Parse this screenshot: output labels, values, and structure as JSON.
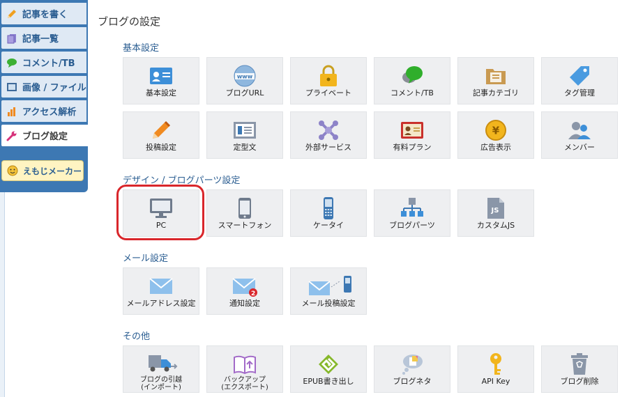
{
  "sidebar": {
    "items": [
      {
        "label": "記事を書く",
        "icon": "pencil-icon"
      },
      {
        "label": "記事一覧",
        "icon": "document-icon"
      },
      {
        "label": "コメント/TB",
        "icon": "comment-icon"
      },
      {
        "label": "画像 / ファイル",
        "icon": "image-icon"
      },
      {
        "label": "アクセス解析",
        "icon": "bar-chart-icon"
      },
      {
        "label": "ブログ設定",
        "icon": "wrench-icon"
      }
    ],
    "emoji_button": "えもじメーカー"
  },
  "page": {
    "title": "ブログの設定"
  },
  "sections": {
    "basic": {
      "title": "基本設定",
      "tiles": [
        {
          "label": "基本設定"
        },
        {
          "label": "ブログURL"
        },
        {
          "label": "プライベート"
        },
        {
          "label": "コメント/TB"
        },
        {
          "label": "記事カテゴリ"
        },
        {
          "label": "タグ管理"
        },
        {
          "label": "投稿設定"
        },
        {
          "label": "定型文"
        },
        {
          "label": "外部サービス"
        },
        {
          "label": "有料プラン"
        },
        {
          "label": "広告表示"
        },
        {
          "label": "メンバー"
        }
      ]
    },
    "design": {
      "title": "デザイン / ブログパーツ設定",
      "tiles": [
        {
          "label": "PC"
        },
        {
          "label": "スマートフォン"
        },
        {
          "label": "ケータイ"
        },
        {
          "label": "ブログパーツ"
        },
        {
          "label": "カスタムJS"
        }
      ]
    },
    "mail": {
      "title": "メール設定",
      "tiles": [
        {
          "label": "メールアドレス設定"
        },
        {
          "label": "通知設定",
          "badge": "2"
        },
        {
          "label": "メール投稿設定"
        }
      ]
    },
    "other": {
      "title": "その他",
      "tiles": [
        {
          "label_line1": "ブログの引越",
          "label_line2": "(インポート)"
        },
        {
          "label_line1": "バックアップ",
          "label_line2": "(エクスポート)"
        },
        {
          "label": "EPUB書き出し"
        },
        {
          "label": "ブログネタ"
        },
        {
          "label": "API Key"
        },
        {
          "label": "ブログ削除"
        }
      ]
    }
  },
  "colors": {
    "sidebar": "#3d78b3",
    "accent_text": "#2a5d91",
    "highlight": "#d9262b",
    "tile_bg": "#eeeff1"
  }
}
